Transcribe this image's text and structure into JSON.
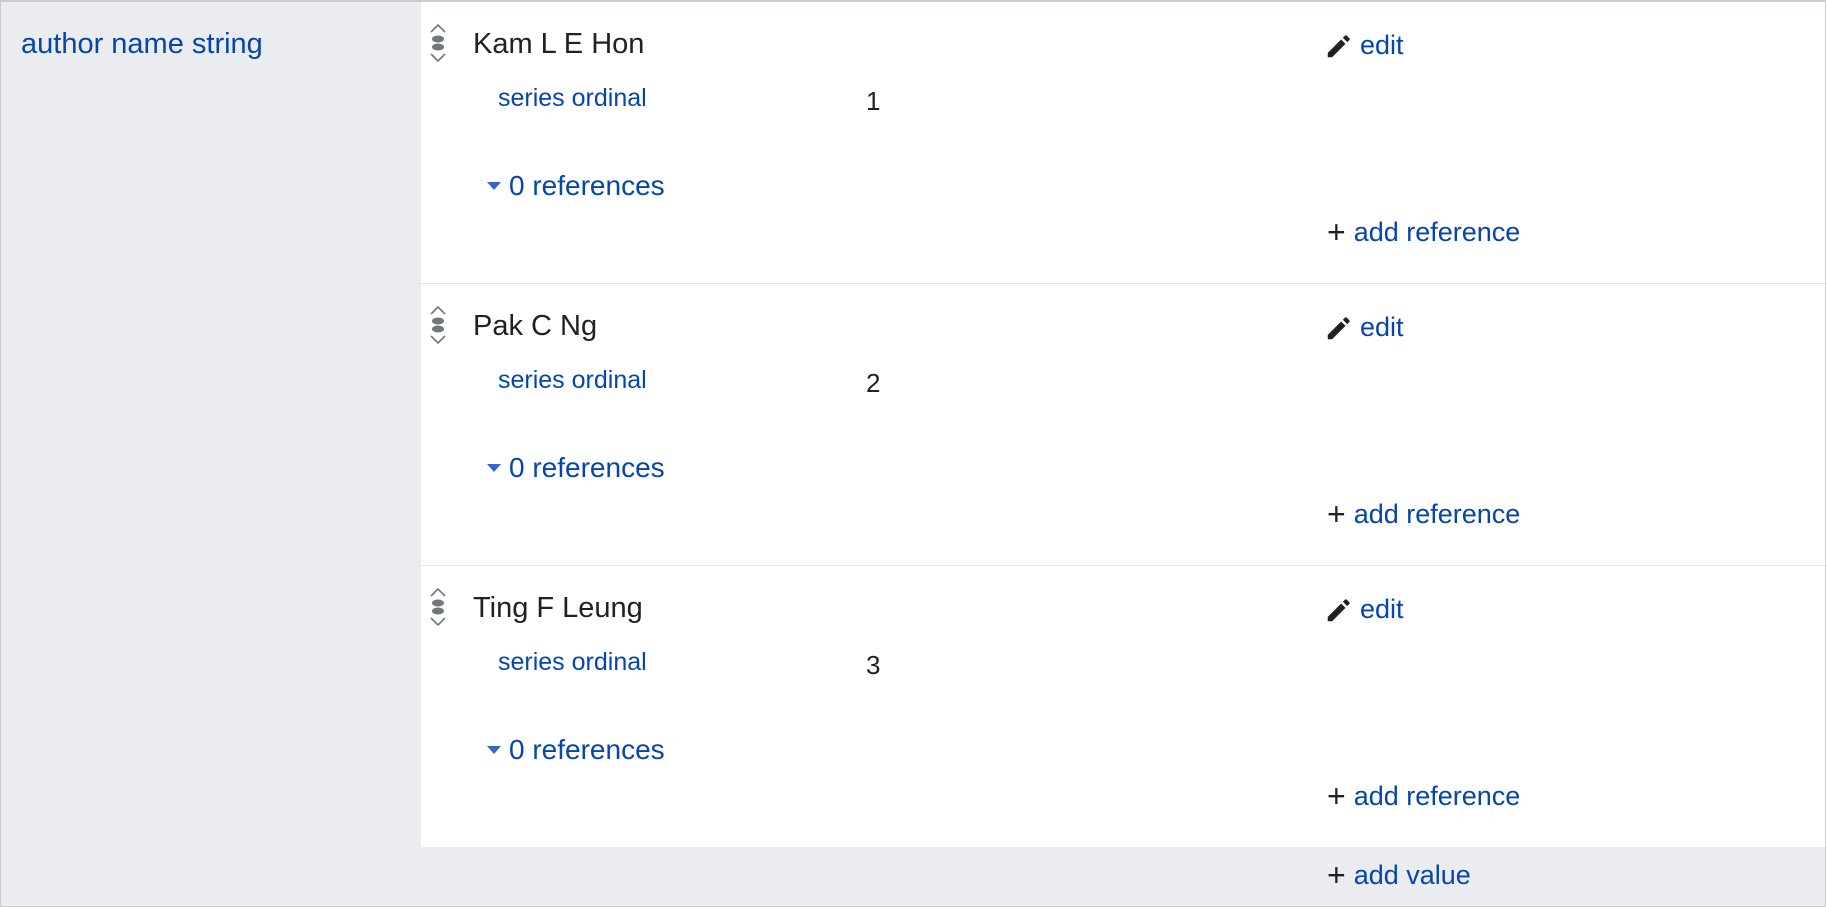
{
  "property": {
    "label": "author name string"
  },
  "statements": [
    {
      "value": "Kam L E Hon",
      "edit_label": "edit",
      "qualifier": {
        "property": "series ordinal",
        "value": "1"
      },
      "references_label": "0 references",
      "add_reference_label": "add reference"
    },
    {
      "value": "Pak C Ng",
      "edit_label": "edit",
      "qualifier": {
        "property": "series ordinal",
        "value": "2"
      },
      "references_label": "0 references",
      "add_reference_label": "add reference"
    },
    {
      "value": "Ting F Leung",
      "edit_label": "edit",
      "qualifier": {
        "property": "series ordinal",
        "value": "3"
      },
      "references_label": "0 references",
      "add_reference_label": "add reference"
    }
  ],
  "add_value_label": "add value",
  "colors": {
    "link": "#0645ad",
    "text": "#202122",
    "sidebar_bg": "#eaecf0",
    "border": "#c8ccd1"
  },
  "icons": {
    "edit": "pencil-icon",
    "rank": "rank-normal-icon",
    "add": "plus-icon",
    "toggle": "triangle-down-icon"
  }
}
